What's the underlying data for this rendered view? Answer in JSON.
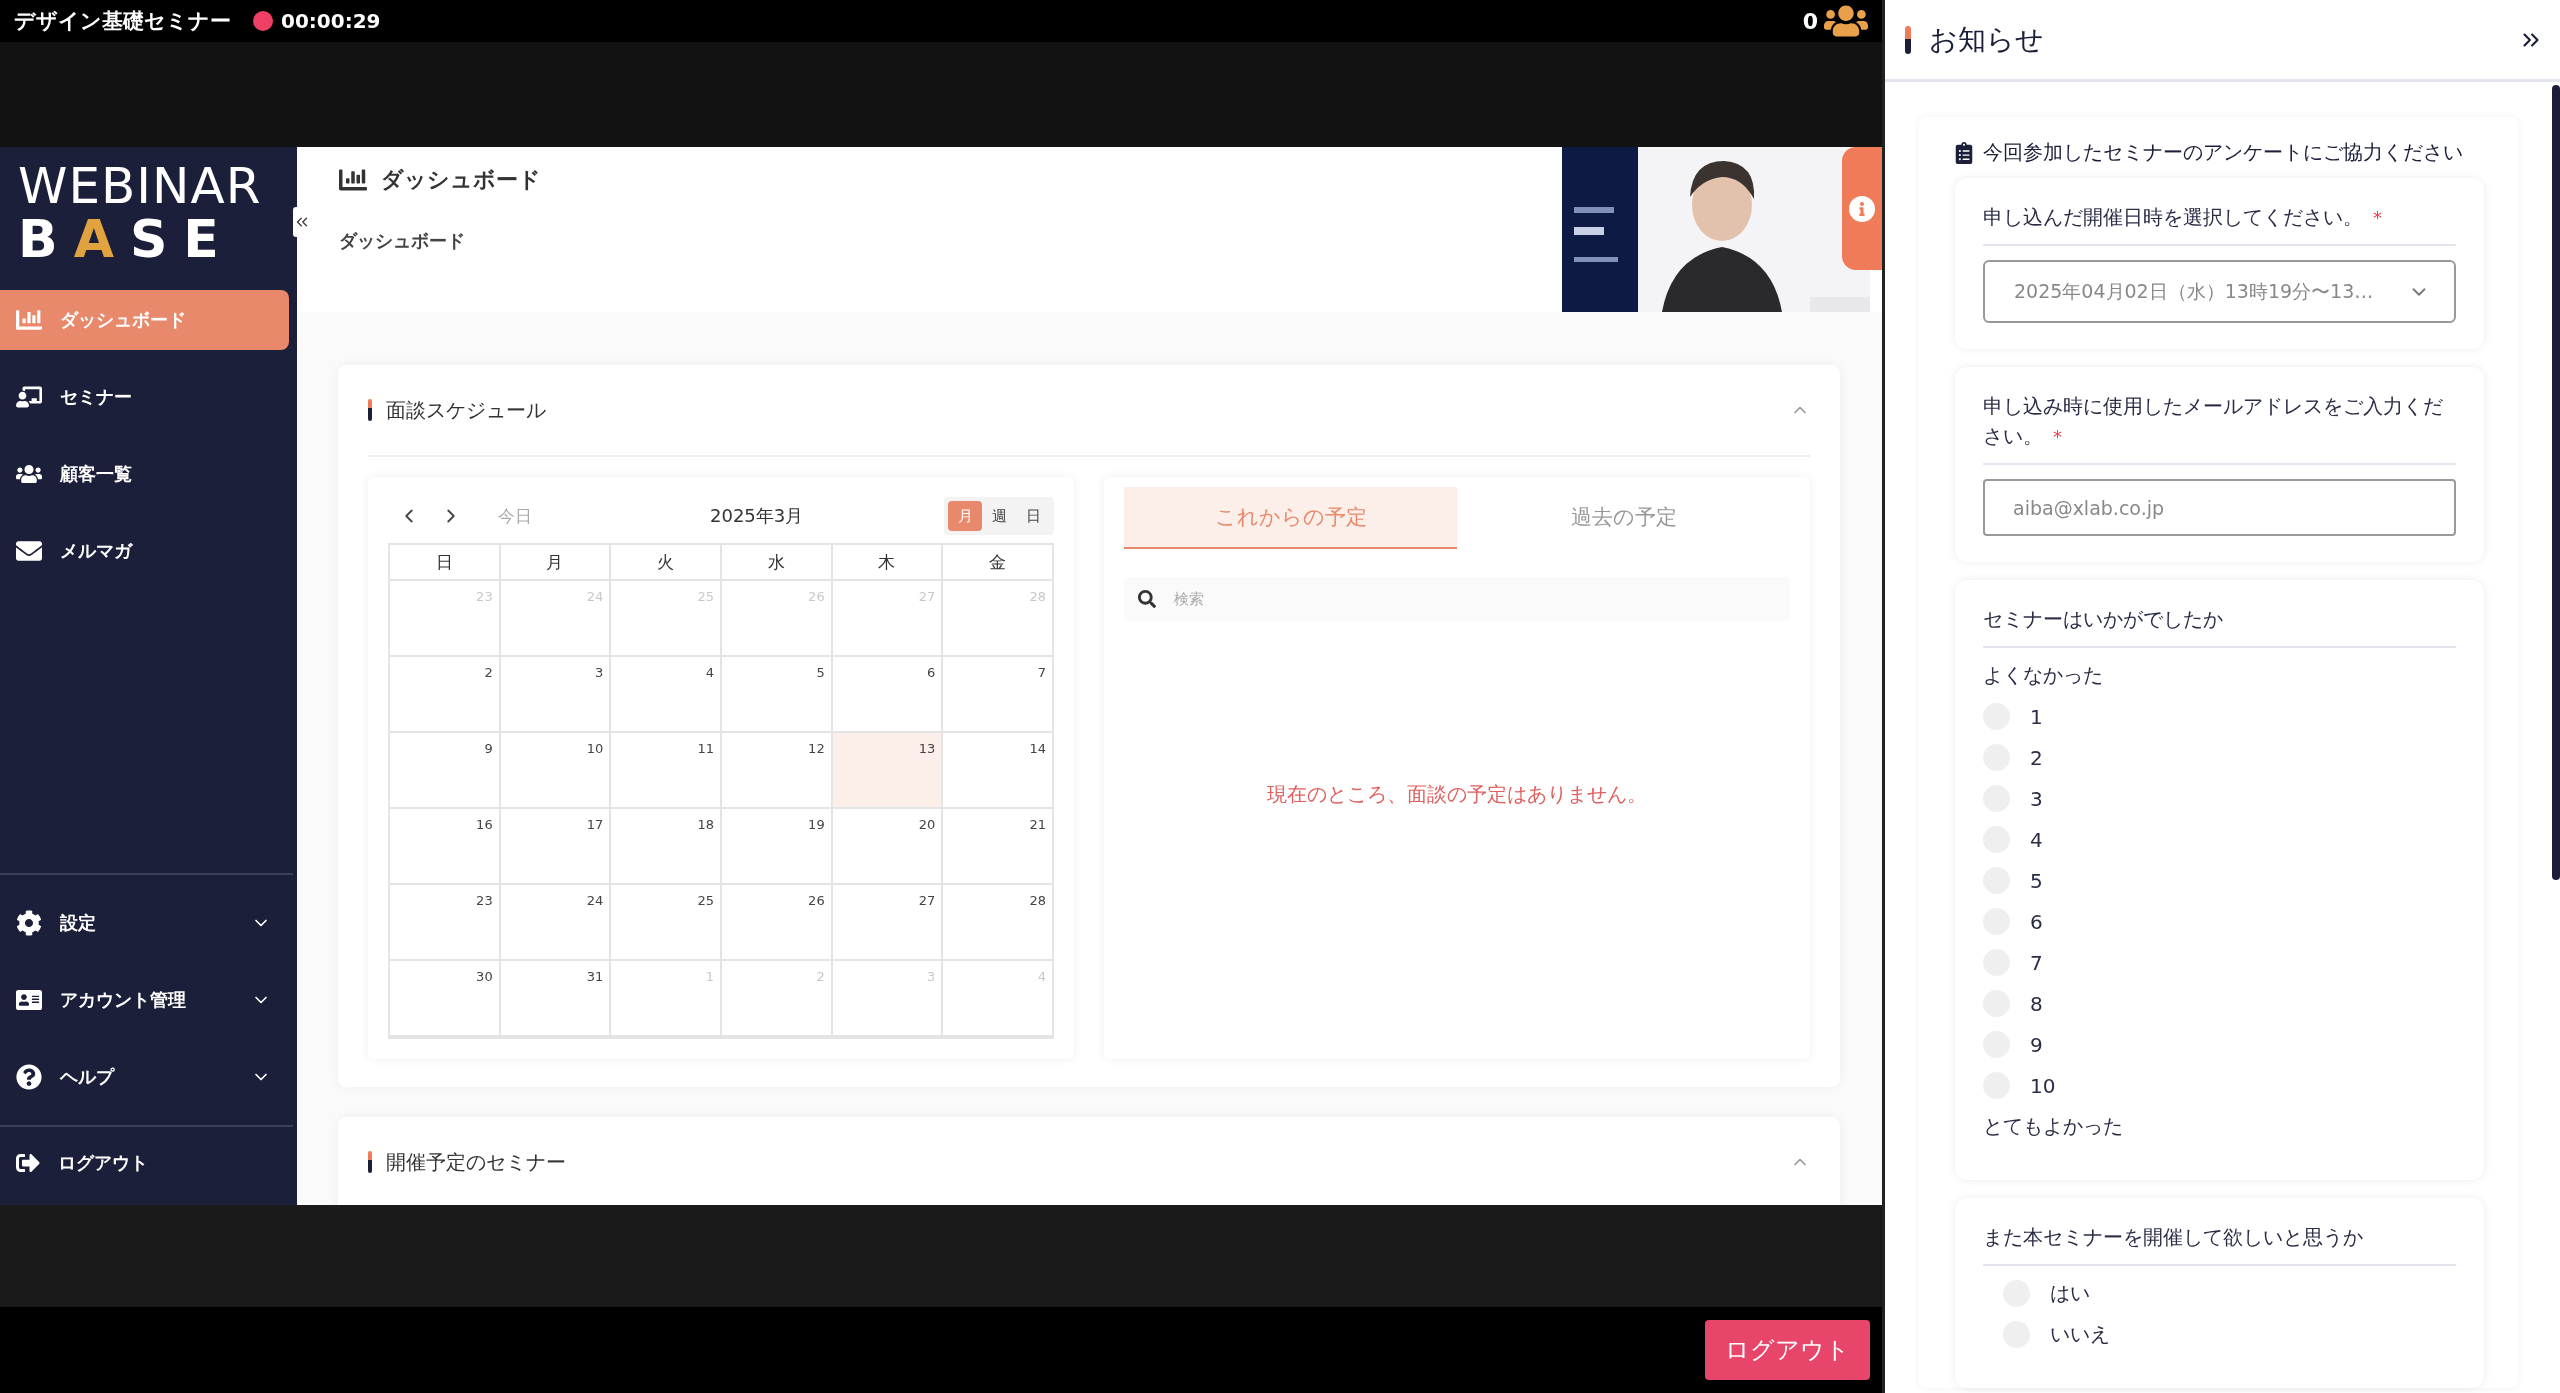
{
  "top_bar": {
    "title": "デザイン基礎セミナー",
    "recording": true,
    "elapsed": "00:00:29",
    "participants": "0"
  },
  "shared_screen": {
    "logo": {
      "line1": "WEBINAR",
      "line2": "BASE"
    },
    "nav": [
      {
        "label": "ダッシュボード",
        "selected": true
      },
      {
        "label": "セミナー",
        "selected": false
      },
      {
        "label": "顧客一覧",
        "selected": false
      },
      {
        "label": "メルマガ",
        "selected": false
      }
    ],
    "menu_groups": [
      {
        "label": "設定",
        "expanded": false
      },
      {
        "label": "アカウント管理",
        "expanded": false
      },
      {
        "label": "ヘルプ",
        "expanded": false
      }
    ],
    "logout": "ログアウト",
    "page_title": "ダッシュボード",
    "breadcrumb": "ダッシュボード",
    "schedule": {
      "title": "面談スケジュール",
      "expanded": true,
      "calendar": {
        "today_label": "今日",
        "month": "2025年3月",
        "views": [
          {
            "label": "月",
            "selected": true
          },
          {
            "label": "週",
            "selected": false
          },
          {
            "label": "日",
            "selected": false
          }
        ],
        "weekdays": [
          "日",
          "月",
          "火",
          "水",
          "木",
          "金"
        ],
        "weeks": [
          [
            {
              "day": "23",
              "muted": true,
              "today": false
            },
            {
              "day": "24",
              "muted": true,
              "today": false
            },
            {
              "day": "25",
              "muted": true,
              "today": false
            },
            {
              "day": "26",
              "muted": true,
              "today": false
            },
            {
              "day": "27",
              "muted": true,
              "today": false
            },
            {
              "day": "28",
              "muted": true,
              "today": false
            }
          ],
          [
            {
              "day": "2",
              "muted": false,
              "today": false
            },
            {
              "day": "3",
              "muted": false,
              "today": false
            },
            {
              "day": "4",
              "muted": false,
              "today": false
            },
            {
              "day": "5",
              "muted": false,
              "today": false
            },
            {
              "day": "6",
              "muted": false,
              "today": false
            },
            {
              "day": "7",
              "muted": false,
              "today": false
            }
          ],
          [
            {
              "day": "9",
              "muted": false,
              "today": false
            },
            {
              "day": "10",
              "muted": false,
              "today": false
            },
            {
              "day": "11",
              "muted": false,
              "today": false
            },
            {
              "day": "12",
              "muted": false,
              "today": false
            },
            {
              "day": "13",
              "muted": false,
              "today": true
            },
            {
              "day": "14",
              "muted": false,
              "today": false
            }
          ],
          [
            {
              "day": "16",
              "muted": false,
              "today": false
            },
            {
              "day": "17",
              "muted": false,
              "today": false
            },
            {
              "day": "18",
              "muted": false,
              "today": false
            },
            {
              "day": "19",
              "muted": false,
              "today": false
            },
            {
              "day": "20",
              "muted": false,
              "today": false
            },
            {
              "day": "21",
              "muted": false,
              "today": false
            }
          ],
          [
            {
              "day": "23",
              "muted": false,
              "today": false
            },
            {
              "day": "24",
              "muted": false,
              "today": false
            },
            {
              "day": "25",
              "muted": false,
              "today": false
            },
            {
              "day": "26",
              "muted": false,
              "today": false
            },
            {
              "day": "27",
              "muted": false,
              "today": false
            },
            {
              "day": "28",
              "muted": false,
              "today": false
            }
          ],
          [
            {
              "day": "30",
              "muted": false,
              "today": false
            },
            {
              "day": "31",
              "muted": false,
              "today": false
            },
            {
              "day": "1",
              "muted": true,
              "today": false
            },
            {
              "day": "2",
              "muted": true,
              "today": false
            },
            {
              "day": "3",
              "muted": true,
              "today": false
            },
            {
              "day": "4",
              "muted": true,
              "today": false
            }
          ]
        ]
      },
      "tabs": [
        {
          "label": "これからの予定",
          "selected": true
        },
        {
          "label": "過去の予定",
          "selected": false
        }
      ],
      "search": {
        "placeholder": "検索"
      },
      "empty_message": "現在のところ、面談の予定はありません。"
    },
    "upcoming": {
      "title": "開催予定のセミナー",
      "expanded": true
    }
  },
  "panel": {
    "title": "お知らせ",
    "survey": {
      "title": "今回参加したセミナーのアンケートにご協力ください",
      "questions": [
        {
          "kind": "select",
          "label": "申し込んだ開催日時を選択してください。",
          "required_mark": "*",
          "value": "2025年04月02日（水）13時19分〜13…"
        },
        {
          "kind": "text",
          "label": "申し込み時に使用したメールアドレスをご入力ください。",
          "required_mark": "*",
          "placeholder": "aiba@xlab.co.jp"
        },
        {
          "kind": "scale",
          "label": "セミナーはいかがでしたか",
          "low_label": "よくなかった",
          "high_label": "とてもよかった",
          "options": [
            {
              "label": "1",
              "selected": false
            },
            {
              "label": "2",
              "selected": false
            },
            {
              "label": "3",
              "selected": false
            },
            {
              "label": "4",
              "selected": false
            },
            {
              "label": "5",
              "selected": false
            },
            {
              "label": "6",
              "selected": false
            },
            {
              "label": "7",
              "selected": false
            },
            {
              "label": "8",
              "selected": false
            },
            {
              "label": "9",
              "selected": false
            },
            {
              "label": "10",
              "selected": false
            }
          ]
        },
        {
          "kind": "radio",
          "label": "また本セミナーを開催して欲しいと思うか",
          "options": [
            {
              "label": "はい",
              "selected": false
            },
            {
              "label": "いいえ",
              "selected": false
            }
          ]
        }
      ]
    }
  },
  "bottom_bar": {
    "logout": "ログアウト"
  }
}
